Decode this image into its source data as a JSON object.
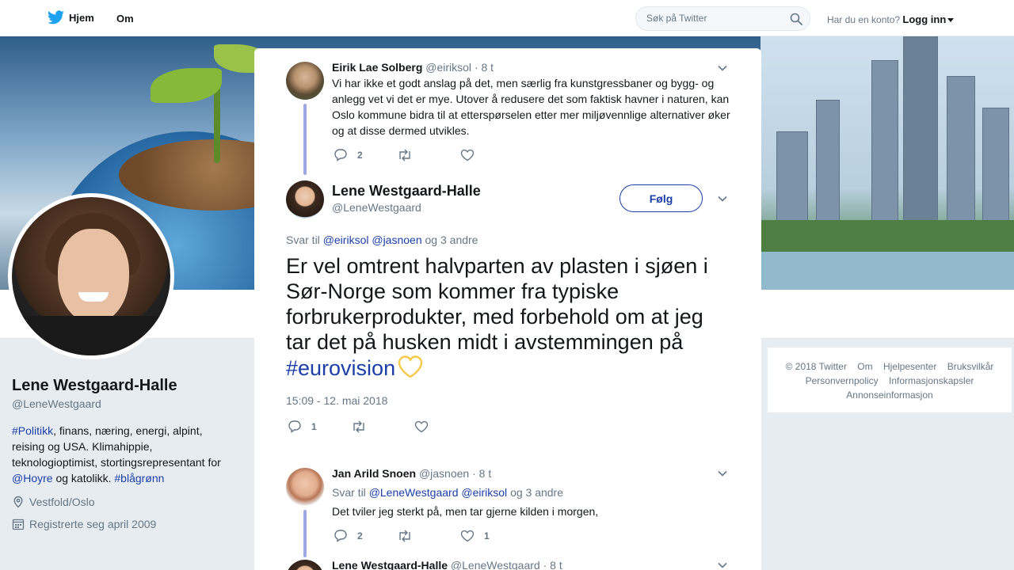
{
  "nav": {
    "home_label": "Hjem",
    "about_label": "Om",
    "search_placeholder": "Søk på Twitter",
    "account_prompt": "Har du en konto?",
    "login_label": "Logg inn"
  },
  "profile": {
    "name": "Lene Westgaard-Halle",
    "handle": "@LeneWestgaard",
    "bio": {
      "tag1": "#Politikk",
      "text1": ", finans, næring, energi, alpint, reising og USA. Klimahippie, teknologioptimist, stortingsrepresentant for ",
      "mention": "@Hoyre",
      "text2": " og katolikk. ",
      "tag2": "#blågrønn"
    },
    "location": "Vestfold/Oslo",
    "joined": "Registrerte seg april 2009"
  },
  "footer": {
    "links": [
      "© 2018 Twitter",
      "Om",
      "Hjelpesenter",
      "Bruksvilkår",
      "Personvernpolicy",
      "Informasjonskapsler",
      "Annonseinformasjon"
    ]
  },
  "modal": {
    "tweet1": {
      "name": "Eirik Lae Solberg",
      "handle": "@eiriksol",
      "time": "· 8 t",
      "text": "Vi har ikke et godt anslag på det, men særlig fra kunstgressbaner og bygg- og anlegg vet vi det er mye. Utover å redusere det som faktisk havner i naturen, kan Oslo kommune bidra til at etterspørselen etter mer miljøvennlige alternativer øker og at disse dermed utvikles.",
      "replies": "2",
      "retweets": "",
      "likes": ""
    },
    "main_tweet": {
      "name": "Lene Westgaard-Halle",
      "handle": "@LeneWestgaard",
      "follow_label": "Følg",
      "reply_prefix": "Svar til",
      "reply_to_1": "@eiriksol",
      "reply_to_2": "@jasnoen",
      "reply_suffix": "og 3 andre",
      "text": "Er vel omtrent halvparten av plasten i sjøen i Sør-Norge som kommer fra typiske forbrukerprodukter, med forbehold om at jeg tar det på husken midt i avstemmingen på ",
      "hashtag": "#eurovision",
      "timestamp": "15:09 - 12. mai 2018",
      "replies": "1",
      "retweets": "",
      "likes": ""
    },
    "tweet3": {
      "name": "Jan Arild Snoen",
      "handle": "@jasnoen",
      "time": "· 8 t",
      "reply_prefix": "Svar til",
      "reply_to_1": "@LeneWestgaard",
      "reply_to_2": "@eiriksol",
      "reply_suffix": "og 3 andre",
      "text": "Det tviler jeg sterkt på, men tar gjerne kilden i morgen,",
      "replies": "2",
      "retweets": "",
      "likes": "1"
    },
    "tweet4": {
      "name": "Lene Westgaard-Halle",
      "handle": "@LeneWestgaard",
      "time": "· 8 t"
    }
  },
  "colors": {
    "link": "#1b3ea8",
    "thread_line": "#9da8e5",
    "muted": "#657786"
  }
}
